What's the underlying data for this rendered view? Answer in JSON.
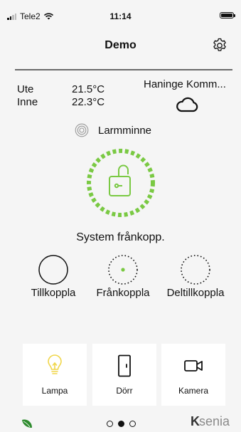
{
  "status_bar": {
    "carrier": "Tele2",
    "time": "11:14"
  },
  "header": {
    "title": "Demo",
    "settings_icon": "gear-icon"
  },
  "climate": {
    "outdoor_label": "Ute",
    "outdoor_temp": "21.5°C",
    "indoor_label": "Inne",
    "indoor_temp": "22.3°C",
    "location": "Haninge Komm...",
    "weather_icon": "cloud-icon"
  },
  "alarm_memory": {
    "label": "Larmminne",
    "icon": "concentric-circles-icon"
  },
  "system": {
    "status": "System frånkopp.",
    "icon": "unlocked-padlock-icon",
    "accent": "#7ac943"
  },
  "modes": [
    {
      "label": "Tillkoppla",
      "icon": "solid-circle-icon"
    },
    {
      "label": "Frånkoppla",
      "icon": "dotted-circle-icon"
    },
    {
      "label": "Deltillkoppla",
      "icon": "dotted-circle-icon"
    }
  ],
  "shortcuts": [
    {
      "label": "Lampa",
      "icon": "lightbulb-icon",
      "color": "#f0d64a"
    },
    {
      "label": "Dörr",
      "icon": "door-icon"
    },
    {
      "label": "Kamera",
      "icon": "video-camera-icon"
    }
  ],
  "footer": {
    "page_count": 3,
    "active_page": 2,
    "brand_k": "K",
    "brand_rest": "senia",
    "leaf_color": "#2e8b2e"
  }
}
